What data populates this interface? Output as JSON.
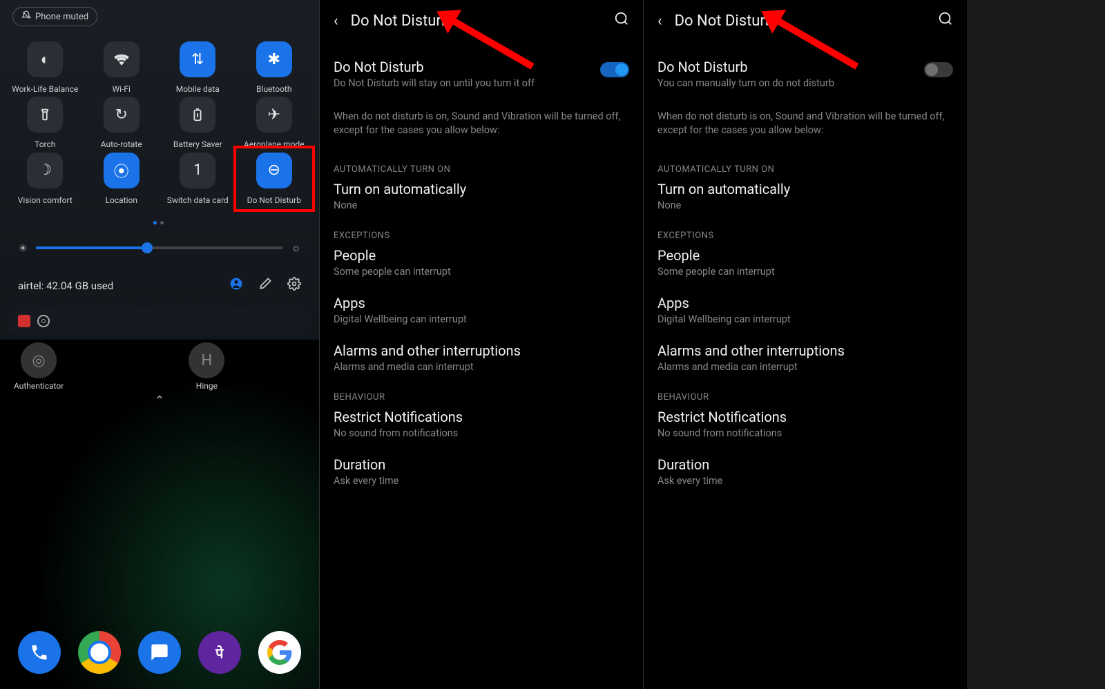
{
  "panel1": {
    "status_chip": "Phone muted",
    "tiles": [
      {
        "label": "Work-Life Balance",
        "icon": "◐",
        "active": false
      },
      {
        "label": "Wi-Fi",
        "icon": "wifi",
        "active": false
      },
      {
        "label": "Mobile data",
        "icon": "⇅",
        "active": true
      },
      {
        "label": "Bluetooth",
        "icon": "✱",
        "active": true
      },
      {
        "label": "Torch",
        "icon": "torch",
        "active": false
      },
      {
        "label": "Auto-rotate",
        "icon": "↻",
        "active": false
      },
      {
        "label": "Battery Saver",
        "icon": "battery",
        "active": false
      },
      {
        "label": "Aeroplane mode",
        "icon": "✈",
        "active": false
      },
      {
        "label": "Vision comfort",
        "icon": "☽",
        "active": false
      },
      {
        "label": "Location",
        "icon": "⦿",
        "active": true
      },
      {
        "label": "Switch data card",
        "icon": "1",
        "active": false
      },
      {
        "label": "Do Not Disturb",
        "icon": "⊖",
        "active": true,
        "highlighted": true
      }
    ],
    "data_usage": "airtel: 42.04 GB used",
    "home_apps": [
      {
        "label": "Authenticator"
      },
      {
        "label": "Hinge"
      }
    ]
  },
  "panel2": {
    "title": "Do Not Disturb",
    "dnd_title": "Do Not Disturb",
    "dnd_sub": "Do Not Disturb will stay on until you turn it off",
    "help": "When do not disturb is on, Sound and Vibration will be turned off, except for the cases you allow below:",
    "section_auto": "AUTOMATICALLY TURN ON",
    "auto_title": "Turn on automatically",
    "auto_sub": "None",
    "section_exc": "EXCEPTIONS",
    "people_title": "People",
    "people_sub": "Some people can interrupt",
    "apps_title": "Apps",
    "apps_sub": "Digital Wellbeing can interrupt",
    "alarms_title": "Alarms and other interruptions",
    "alarms_sub": "Alarms and media can interrupt",
    "section_beh": "BEHAVIOUR",
    "restrict_title": "Restrict Notifications",
    "restrict_sub": "No sound from notifications",
    "duration_title": "Duration",
    "duration_sub": "Ask every time"
  },
  "panel3": {
    "title": "Do Not Disturb",
    "dnd_title": "Do Not Disturb",
    "dnd_sub": "You can manually turn on do not disturb",
    "help": "When do not disturb is on, Sound and Vibration will be turned off, except for the cases you allow below:",
    "section_auto": "AUTOMATICALLY TURN ON",
    "auto_title": "Turn on automatically",
    "auto_sub": "None",
    "section_exc": "EXCEPTIONS",
    "people_title": "People",
    "people_sub": "Some people can interrupt",
    "apps_title": "Apps",
    "apps_sub": "Digital Wellbeing can interrupt",
    "alarms_title": "Alarms and other interruptions",
    "alarms_sub": "Alarms and media can interrupt",
    "section_beh": "BEHAVIOUR",
    "restrict_title": "Restrict Notifications",
    "restrict_sub": "No sound from notifications",
    "duration_title": "Duration",
    "duration_sub": "Ask every time"
  }
}
